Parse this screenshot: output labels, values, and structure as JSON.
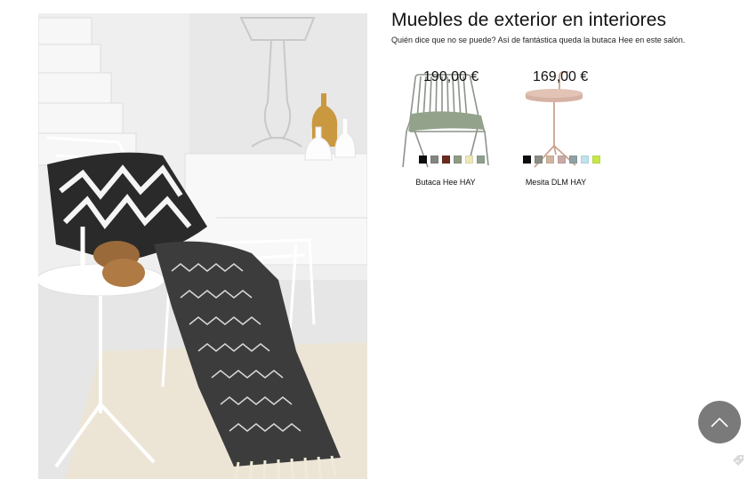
{
  "article": {
    "title": "Muebles de exterior en interiores",
    "subtitle": "Quién dice que no se puede? Así de fantástica queda la butaca Hee en este salón."
  },
  "hero_image": {
    "icon": "living-room-photo"
  },
  "products": [
    {
      "name": "Butaca Hee HAY",
      "price": "190,00 €",
      "icon": "lounge-chair-thumbnail",
      "swatches": [
        "#0d0d0d",
        "#858580",
        "#6b2a1e",
        "#8f9b85",
        "#ece9b8",
        "#8da090"
      ]
    },
    {
      "name": "Mesita DLM HAY",
      "price": "169,00 €",
      "icon": "side-table-thumbnail",
      "swatches": [
        "#0d0d0d",
        "#8a8e86",
        "#d1b59f",
        "#c8aba7",
        "#8fa1a3",
        "#bfe2ec",
        "#c7e64a"
      ]
    }
  ],
  "ui": {
    "scroll_top_icon": "chevron-up-icon",
    "corner_icon": "tag-icon",
    "scroll_top_color": "#7a7a7a"
  }
}
